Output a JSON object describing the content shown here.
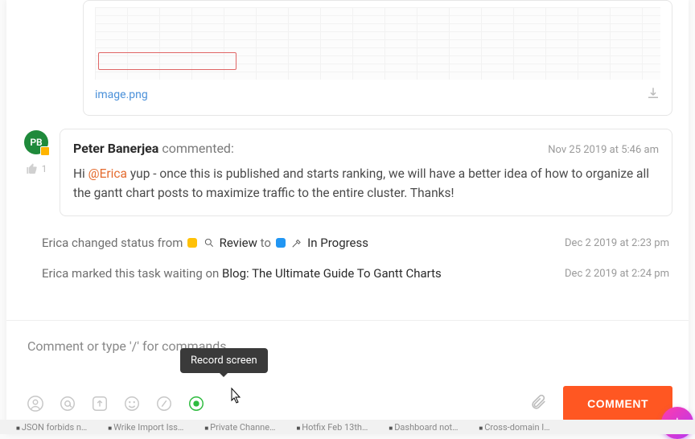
{
  "attachment": {
    "filename": "image.png"
  },
  "comment": {
    "avatar_initials": "PB",
    "author": "Peter Banerjea",
    "verb": "commented:",
    "timestamp": "Nov 25 2019 at 5:46 am",
    "like_count": "1",
    "body_pre": "Hi ",
    "mention": "@Erica",
    "body_post": " yup - once this is published and starts ranking, we will have a better idea of how to organize all the gantt chart posts to maximize traffic to the entire cluster. Thanks!"
  },
  "activity": {
    "status_change": {
      "actor": "Erica",
      "verb": "changed status from",
      "from": "Review",
      "to_word": "to",
      "to": "In Progress",
      "timestamp": "Dec 2 2019 at 2:23 pm"
    },
    "waiting": {
      "actor": "Erica",
      "verb": "marked this task waiting on",
      "task": "Blog: The Ultimate Guide To Gantt Charts",
      "timestamp": "Dec 2 2019 at 2:24 pm"
    }
  },
  "compose": {
    "placeholder": "Comment or type '/' for commands",
    "tooltip": "Record screen",
    "button": "COMMENT"
  },
  "tabs": [
    "JSON forbids n…",
    "Wrike Import Iss…",
    "Private Channe…",
    "Hotfix Feb 13th…",
    "Dashboard not…",
    "Cross-domain I…"
  ]
}
